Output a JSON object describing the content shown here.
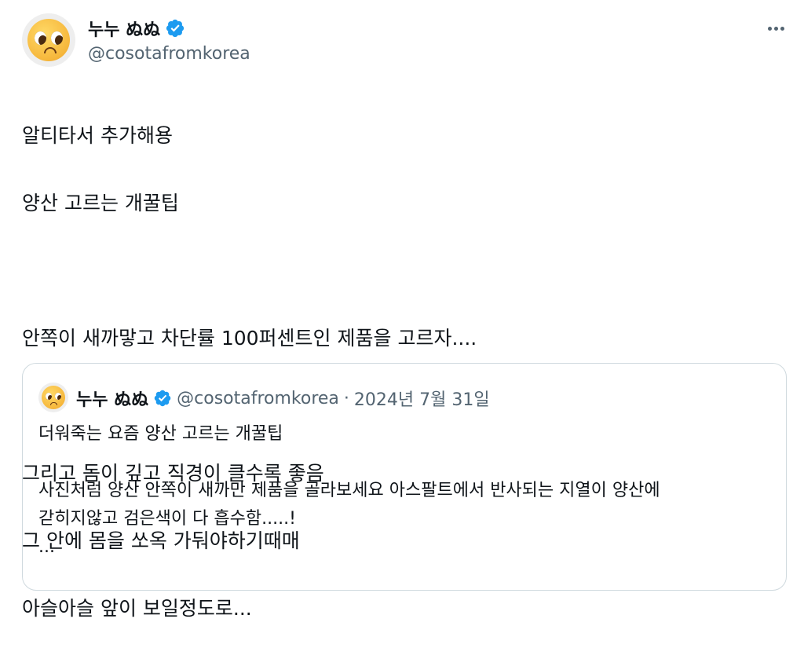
{
  "author": {
    "display_name": "누누 ぬぬ",
    "handle": "@cosotafromkorea",
    "avatar": "pleading-face-emoji",
    "verified": true
  },
  "tweet": {
    "lines": [
      "알티타서 추가해용",
      "양산 고르는 개꿀팁",
      "",
      "안쪽이 새까맣고 차단률 100퍼센트인 제품을 고르자....",
      "",
      "그리고 돔이 깊고 직경이 클수록 좋음",
      "그 안에 몸을 쏘옥 가둬야하기때매",
      "아슬아슬 앞이 보일정도로..."
    ]
  },
  "quoted": {
    "display_name": "누누 ぬぬ",
    "handle": "@cosotafromkorea",
    "separator": "·",
    "date": "2024년 7월 31일",
    "lines": [
      "더워죽는 요즘 양산 고르는 개꿀팁",
      "",
      "사진처럼 양산 안쪽이 새까만 제품을 골라보세요 아스팔트에서 반사되는 지열이 양산에",
      "갇히지않고 검은색이 다 흡수함.....!",
      "..."
    ]
  },
  "icons": {
    "verified": "verified-badge-icon",
    "more": "more-options-icon"
  },
  "colors": {
    "verified_blue": "#1d9bf0",
    "secondary_text": "#536471",
    "border": "#cfd9de"
  }
}
